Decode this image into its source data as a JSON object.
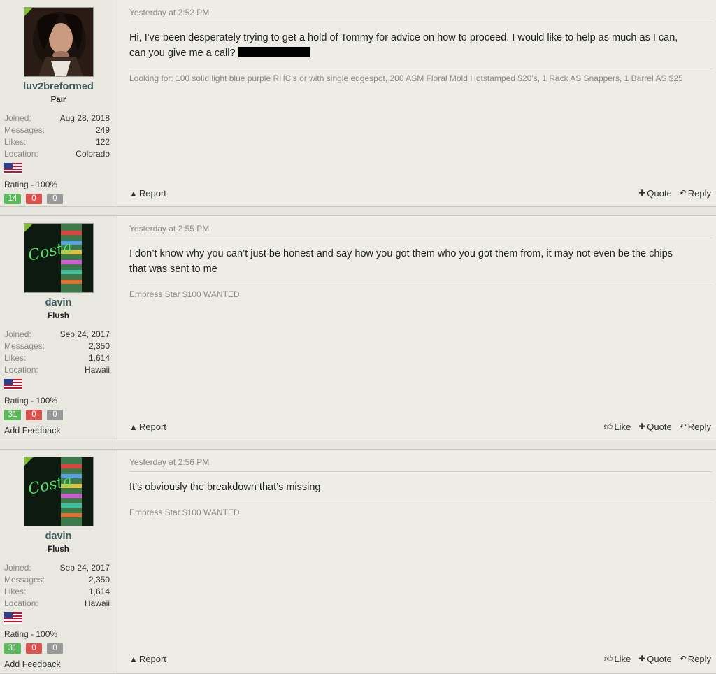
{
  "posts": [
    {
      "user": {
        "name": "luv2breformed",
        "title": "Pair",
        "joined_label": "Joined:",
        "joined": "Aug 28, 2018",
        "messages_label": "Messages:",
        "messages": "249",
        "likes_label": "Likes:",
        "likes": "122",
        "location_label": "Location:",
        "location": "Colorado",
        "rating": "Rating - 100%",
        "pos": "14",
        "neg": "0",
        "neu": "0"
      },
      "date": "Yesterday at 2:52 PM",
      "message_line1": "Hi, I've been desperately trying to get a hold of Tommy for advice on how to proceed. I would like to help as much as I can,",
      "message_line2": "can you give me a call?",
      "signature": "Looking for: 100 solid light blue purple RHC's or with single edgespot, 200 ASM Floral Mold Hotstamped $20's, 1 Rack AS Snappers, 1 Barrel AS $25",
      "actions": {
        "report": "Report",
        "quote": "Quote",
        "reply": "Reply"
      }
    },
    {
      "user": {
        "name": "davin",
        "title": "Flush",
        "joined_label": "Joined:",
        "joined": "Sep 24, 2017",
        "messages_label": "Messages:",
        "messages": "2,350",
        "likes_label": "Likes:",
        "likes": "1,614",
        "location_label": "Location:",
        "location": "Hawaii",
        "rating": "Rating - 100%",
        "pos": "31",
        "neg": "0",
        "neu": "0",
        "add_feedback": "Add Feedback"
      },
      "date": "Yesterday at 2:55 PM",
      "message_line1": "I don’t know why you can’t just be honest and say how you got them who you got them from, it may not even be the chips",
      "message_line2": "that was sent to me",
      "signature": "Empress Star $100 WANTED",
      "actions": {
        "report": "Report",
        "like": "Like",
        "quote": "Quote",
        "reply": "Reply"
      }
    },
    {
      "user": {
        "name": "davin",
        "title": "Flush",
        "joined_label": "Joined:",
        "joined": "Sep 24, 2017",
        "messages_label": "Messages:",
        "messages": "2,350",
        "likes_label": "Likes:",
        "likes": "1,614",
        "location_label": "Location:",
        "location": "Hawaii",
        "rating": "Rating - 100%",
        "pos": "31",
        "neg": "0",
        "neu": "0",
        "add_feedback": "Add Feedback"
      },
      "date": "Yesterday at 2:56 PM",
      "message_line1": "It’s obviously the breakdown that’s missing",
      "signature": "Empress Star $100 WANTED",
      "actions": {
        "report": "Report",
        "like": "Like",
        "quote": "Quote",
        "reply": "Reply"
      }
    }
  ],
  "colors": {
    "online": "#7fbf2f",
    "positive": "#5cb85c",
    "negative": "#d9534f",
    "neutral": "#999999",
    "username": "#3d5a5a"
  }
}
